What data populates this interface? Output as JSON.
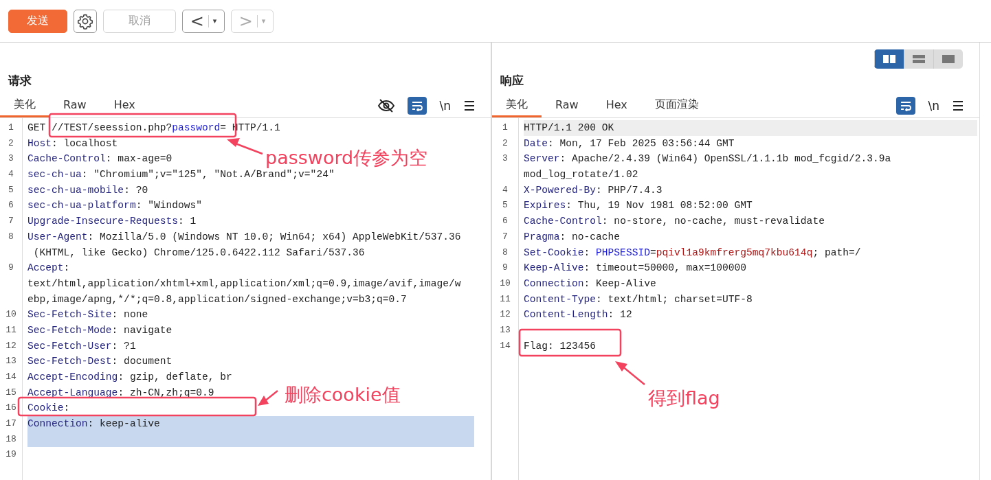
{
  "toolbar": {
    "send": {
      "label": "发送"
    },
    "cancel": {
      "label": "取消",
      "disabled": true
    },
    "back": {
      "label": "<",
      "caret": "▾",
      "disabled": false
    },
    "forward": {
      "label": ">",
      "caret": "▾",
      "disabled": true
    }
  },
  "request": {
    "title": "请求",
    "tabs": [
      {
        "label": "美化",
        "selected": true
      },
      {
        "label": "Raw",
        "selected": false
      },
      {
        "label": "Hex",
        "selected": false
      }
    ],
    "tools": [
      {
        "kind": "eye-off"
      },
      {
        "kind": "wrap",
        "on": true
      },
      {
        "kind": "text",
        "label": "\\n"
      },
      {
        "kind": "menu"
      }
    ],
    "lines": [
      {
        "num": "1",
        "parts": [
          {
            "kind": "plain",
            "text": "GET //TEST/seession.php?"
          },
          {
            "kind": "param",
            "text": "password"
          },
          {
            "kind": "plain",
            "text": "= HTTP/1.1"
          }
        ]
      },
      {
        "num": "2",
        "parts": [
          {
            "kind": "key",
            "text": "Host"
          },
          {
            "kind": "plain",
            "text": ": localhost"
          }
        ]
      },
      {
        "num": "3",
        "parts": [
          {
            "kind": "key",
            "text": "Cache-Control"
          },
          {
            "kind": "plain",
            "text": ": max-age=0"
          }
        ]
      },
      {
        "num": "4",
        "parts": [
          {
            "kind": "key",
            "text": "sec-ch-ua"
          },
          {
            "kind": "plain",
            "text": ": \"Chromium\";v=\"125\", \"Not.A/Brand\";v=\"24\""
          }
        ]
      },
      {
        "num": "5",
        "parts": [
          {
            "kind": "key",
            "text": "sec-ch-ua-mobile"
          },
          {
            "kind": "plain",
            "text": ": ?0"
          }
        ]
      },
      {
        "num": "6",
        "parts": [
          {
            "kind": "key",
            "text": "sec-ch-ua-platform"
          },
          {
            "kind": "plain",
            "text": ": \"Windows\""
          }
        ]
      },
      {
        "num": "7",
        "parts": [
          {
            "kind": "key",
            "text": "Upgrade-Insecure-Requests"
          },
          {
            "kind": "plain",
            "text": ": 1"
          }
        ]
      },
      {
        "num": "8",
        "parts": [
          {
            "kind": "key",
            "text": "User-Agent"
          },
          {
            "kind": "plain",
            "text": ": Mozilla/5.0 (Windows NT 10.0; Win64; x64) AppleWebKit/537.36"
          }
        ]
      },
      {
        "parts": [
          {
            "kind": "plain",
            "text": " (KHTML, like Gecko) Chrome/125.0.6422.112 Safari/537.36"
          }
        ]
      },
      {
        "num": "9",
        "parts": [
          {
            "kind": "key",
            "text": "Accept"
          },
          {
            "kind": "plain",
            "text": ":"
          }
        ]
      },
      {
        "parts": [
          {
            "kind": "plain",
            "text": "text/html,application/xhtml+xml,application/xml;q=0.9,image/avif,image/w"
          }
        ]
      },
      {
        "parts": [
          {
            "kind": "plain",
            "text": "ebp,image/apng,*/*;q=0.8,application/signed-exchange;v=b3;q=0.7"
          }
        ]
      },
      {
        "num": "10",
        "parts": [
          {
            "kind": "key",
            "text": "Sec-Fetch-Site"
          },
          {
            "kind": "plain",
            "text": ": none"
          }
        ]
      },
      {
        "num": "11",
        "parts": [
          {
            "kind": "key",
            "text": "Sec-Fetch-Mode"
          },
          {
            "kind": "plain",
            "text": ": navigate"
          }
        ]
      },
      {
        "num": "12",
        "parts": [
          {
            "kind": "key",
            "text": "Sec-Fetch-User"
          },
          {
            "kind": "plain",
            "text": ": ?1"
          }
        ]
      },
      {
        "num": "13",
        "parts": [
          {
            "kind": "key",
            "text": "Sec-Fetch-Dest"
          },
          {
            "kind": "plain",
            "text": ": document"
          }
        ]
      },
      {
        "num": "14",
        "parts": [
          {
            "kind": "key",
            "text": "Accept-Encoding"
          },
          {
            "kind": "plain",
            "text": ": gzip, deflate, br"
          }
        ]
      },
      {
        "num": "15",
        "parts": [
          {
            "kind": "key",
            "text": "Accept-Language"
          },
          {
            "kind": "plain",
            "text": ": zh-CN,zh;q=0.9"
          }
        ]
      },
      {
        "num": "16",
        "parts": [
          {
            "kind": "key",
            "text": "Cookie"
          },
          {
            "kind": "plain",
            "text": ":"
          }
        ]
      },
      {
        "num": "17",
        "selected": true,
        "parts": [
          {
            "kind": "key",
            "text": "Connection"
          },
          {
            "kind": "plain",
            "text": ": keep-alive"
          }
        ]
      },
      {
        "num": "18",
        "selected": true
      },
      {
        "num": "19"
      }
    ]
  },
  "response": {
    "title": "响应",
    "view_modes": [
      {
        "kind": "columns",
        "selected": true
      },
      {
        "kind": "rows",
        "selected": false
      },
      {
        "kind": "single",
        "selected": false
      }
    ],
    "tabs": [
      {
        "label": "美化",
        "selected": true
      },
      {
        "label": "Raw",
        "selected": false
      },
      {
        "label": "Hex",
        "selected": false
      },
      {
        "label": "页面渲染",
        "selected": false
      }
    ],
    "tools": [
      {
        "kind": "wrap",
        "on": true
      },
      {
        "kind": "text",
        "label": "\\n"
      },
      {
        "kind": "menu"
      }
    ],
    "lines": [
      {
        "num": "1",
        "current": true,
        "parts": [
          {
            "kind": "plain",
            "text": "HTTP/1.1 200 OK"
          }
        ]
      },
      {
        "num": "2",
        "parts": [
          {
            "kind": "key",
            "text": "Date"
          },
          {
            "kind": "plain",
            "text": ": Mon, 17 Feb 2025 03:56:44 GMT"
          }
        ]
      },
      {
        "num": "3",
        "parts": [
          {
            "kind": "key",
            "text": "Server"
          },
          {
            "kind": "plain",
            "text": ": Apache/2.4.39 (Win64) OpenSSL/1.1.1b mod_fcgid/2.3.9a"
          }
        ]
      },
      {
        "parts": [
          {
            "kind": "plain",
            "text": "mod_log_rotate/1.02"
          }
        ]
      },
      {
        "num": "4",
        "parts": [
          {
            "kind": "key",
            "text": "X-Powered-By"
          },
          {
            "kind": "plain",
            "text": ": PHP/7.4.3"
          }
        ]
      },
      {
        "num": "5",
        "parts": [
          {
            "kind": "key",
            "text": "Expires"
          },
          {
            "kind": "plain",
            "text": ": Thu, 19 Nov 1981 08:52:00 GMT"
          }
        ]
      },
      {
        "num": "6",
        "parts": [
          {
            "kind": "key",
            "text": "Cache-Control"
          },
          {
            "kind": "plain",
            "text": ": no-store, no-cache, must-revalidate"
          }
        ]
      },
      {
        "num": "7",
        "parts": [
          {
            "kind": "key",
            "text": "Pragma"
          },
          {
            "kind": "plain",
            "text": ": no-cache"
          }
        ]
      },
      {
        "num": "8",
        "parts": [
          {
            "kind": "key",
            "text": "Set-Cookie"
          },
          {
            "kind": "plain",
            "text": ": "
          },
          {
            "kind": "param",
            "text": "PHPSESSID"
          },
          {
            "kind": "plain",
            "text": "="
          },
          {
            "kind": "value",
            "text": "pqivl1a9kmfrerg5mq7kbu614q"
          },
          {
            "kind": "plain",
            "text": "; path=/"
          }
        ]
      },
      {
        "num": "9",
        "parts": [
          {
            "kind": "key",
            "text": "Keep-Alive"
          },
          {
            "kind": "plain",
            "text": ": timeout=50000, max=100000"
          }
        ]
      },
      {
        "num": "10",
        "parts": [
          {
            "kind": "key",
            "text": "Connection"
          },
          {
            "kind": "plain",
            "text": ": Keep-Alive"
          }
        ]
      },
      {
        "num": "11",
        "parts": [
          {
            "kind": "key",
            "text": "Content-Type"
          },
          {
            "kind": "plain",
            "text": ": text/html; charset=UTF-8"
          }
        ]
      },
      {
        "num": "12",
        "parts": [
          {
            "kind": "key",
            "text": "Content-Length"
          },
          {
            "kind": "plain",
            "text": ": 12"
          }
        ]
      },
      {
        "num": "13"
      },
      {
        "num": "14",
        "parts": [
          {
            "kind": "plain",
            "text": "Flag: 123456"
          }
        ]
      }
    ]
  },
  "annotations": [
    {
      "text": "password传参为空"
    },
    {
      "text": "删除cookie值"
    },
    {
      "text": "得到flag"
    }
  ]
}
